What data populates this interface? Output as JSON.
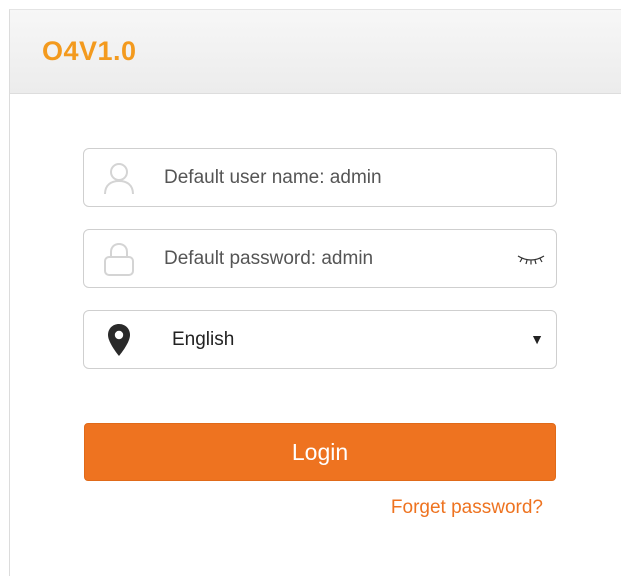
{
  "header": {
    "title": "O4V1.0"
  },
  "login_form": {
    "username": {
      "placeholder": "Default user name: admin",
      "value": "",
      "icon": "user-icon"
    },
    "password": {
      "placeholder": "Default password: admin",
      "value": "",
      "icon": "lock-icon",
      "toggle_icon": "eye-closed-icon"
    },
    "language": {
      "selected": "English",
      "icon": "location-pin-icon"
    },
    "login_label": "Login",
    "forget_label": "Forget password?"
  },
  "colors": {
    "brand": "#f39a1e",
    "accent": "#ee7320"
  }
}
